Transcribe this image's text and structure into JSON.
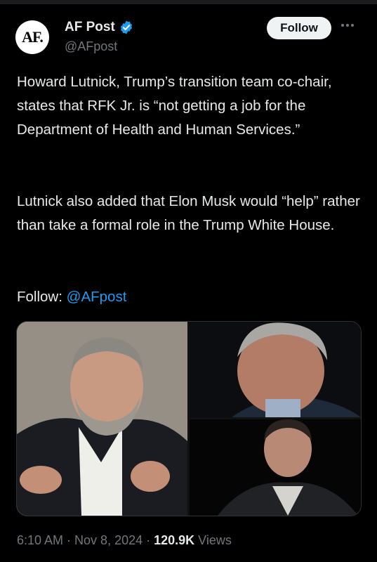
{
  "author": {
    "avatar_text": "AF.",
    "name": "AF Post",
    "handle": "@AFpost",
    "verified_icon": "verified-badge-icon"
  },
  "actions": {
    "follow_label": "Follow",
    "more_icon": "more-options-icon"
  },
  "tweet": {
    "paragraph1": "Howard Lutnick, Trump’s transition team co-chair, states that RFK Jr. is “not getting a job for the Department of Health and Human Services.”",
    "paragraph2": "Lutnick also added that Elon Musk would “help” rather than take a formal role in the Trump White House.",
    "follow_prefix": "Follow: ",
    "follow_mention": "@AFpost"
  },
  "meta": {
    "time": "6:10 AM",
    "date": "Nov 8, 2024",
    "separator": " · ",
    "views_count": "120.9K",
    "views_label": " Views"
  },
  "colors": {
    "background": "#000000",
    "text": "#e7e9ea",
    "secondary": "#71767b",
    "link": "#1d9bf0",
    "verified": "#1d9bf0"
  }
}
